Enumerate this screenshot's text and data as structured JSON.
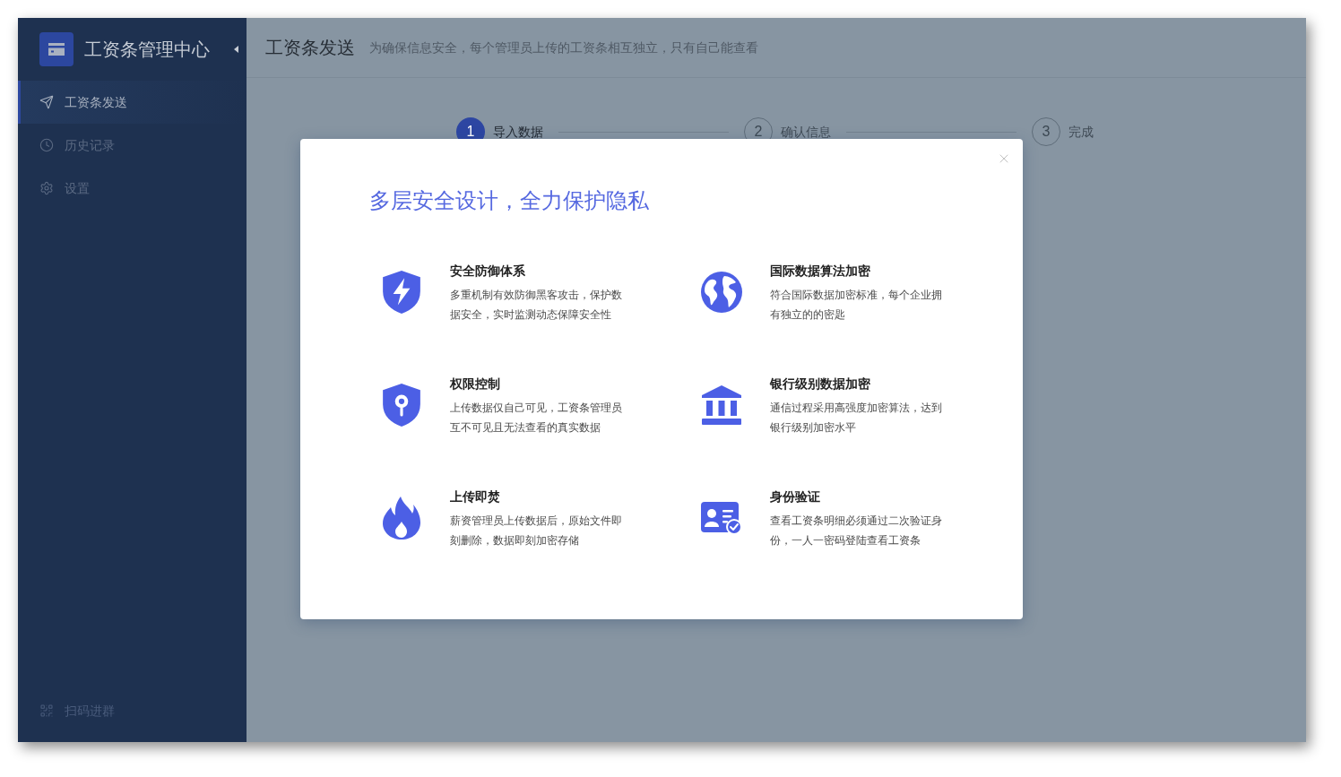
{
  "sidebar": {
    "title": "工资条管理中心",
    "items": [
      {
        "kind": "send",
        "label": "工资条发送",
        "selected": true
      },
      {
        "kind": "history",
        "label": "历史记录",
        "selected": false
      },
      {
        "kind": "settings",
        "label": "设置",
        "selected": false
      }
    ],
    "footer": {
      "label": "扫码进群"
    }
  },
  "header": {
    "title": "工资条发送",
    "subtitle": "为确保信息安全，每个管理员上传的工资条相互独立，只有自己能查看"
  },
  "steps": [
    {
      "number": "1",
      "label": "导入数据",
      "active": true
    },
    {
      "number": "2",
      "label": "确认信息",
      "active": false
    },
    {
      "number": "3",
      "label": "完成",
      "active": false
    }
  ],
  "modal": {
    "title": "多层安全设计，全力保护隐私",
    "features": [
      {
        "kind": "shield",
        "title": "安全防御体系",
        "description": "多重机制有效防御黑客攻击，保护数据安全，实时监测动态保障安全性"
      },
      {
        "kind": "globe",
        "title": "国际数据算法加密",
        "description": "符合国际数据加密标准，每个企业拥有独立的的密匙"
      },
      {
        "kind": "keyhole",
        "title": "权限控制",
        "description": "上传数据仅自己可见，工资条管理员互不可见且无法查看的真实数据"
      },
      {
        "kind": "bank",
        "title": "银行级别数据加密",
        "description": "通信过程采用高强度加密算法，达到银行级别加密水平"
      },
      {
        "kind": "flame",
        "title": "上传即焚",
        "description": "薪资管理员上传数据后，原始文件即刻删除，数据即刻加密存储"
      },
      {
        "kind": "idcard",
        "title": "身份验证",
        "description": "查看工资条明细必须通过二次验证身份，一人一密码登陆查看工资条"
      }
    ]
  }
}
